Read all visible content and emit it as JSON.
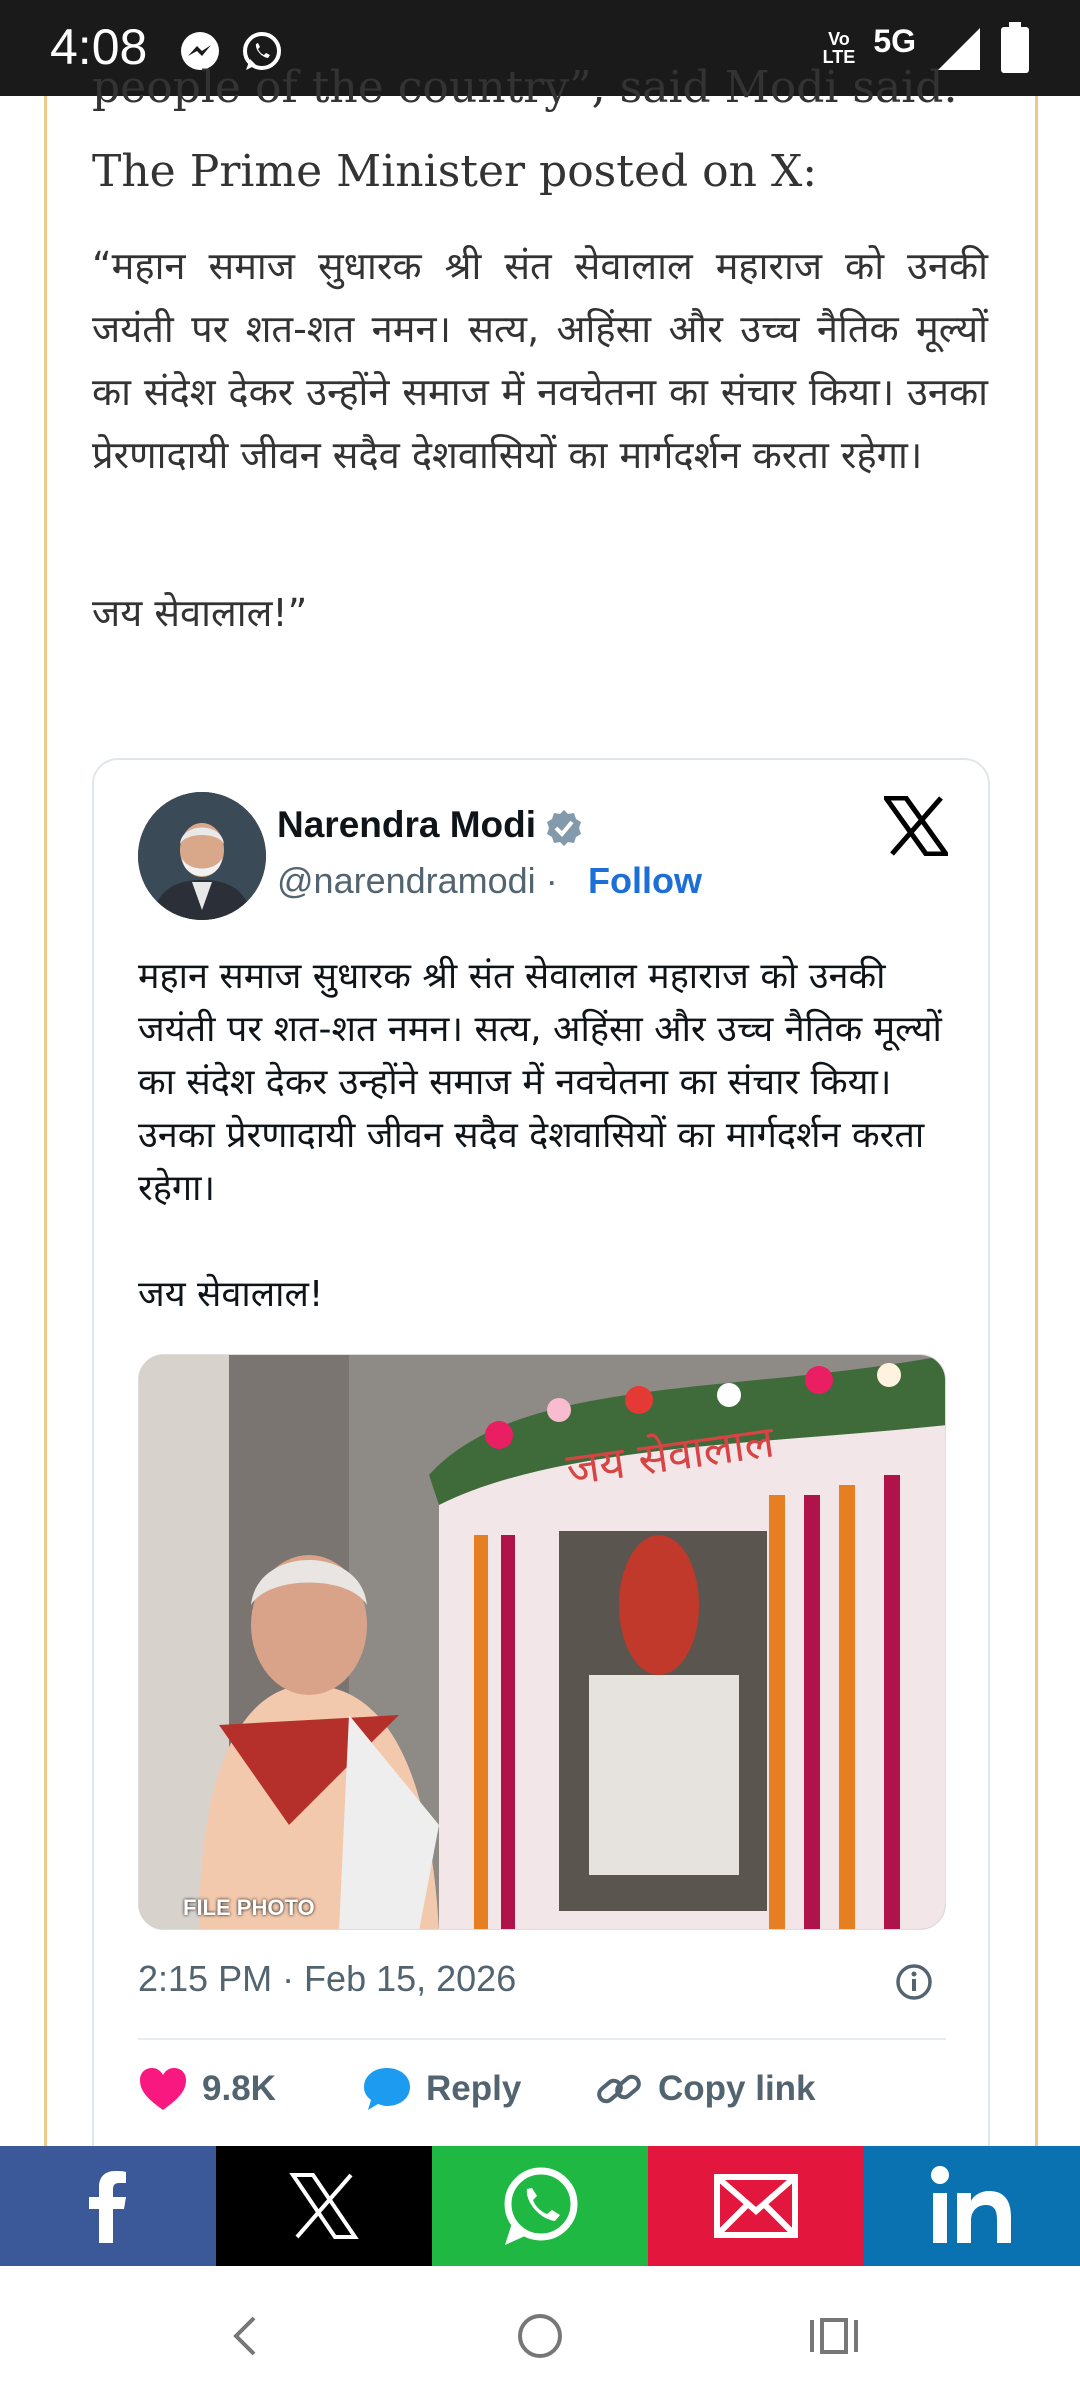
{
  "status_bar": {
    "time": "4:08",
    "volte_line1": "Vo",
    "volte_line2": "LTE",
    "network": "5G",
    "app_icons": [
      "messenger-icon",
      "whatsapp-icon"
    ],
    "right_icons": [
      "signal-icon",
      "battery-icon"
    ]
  },
  "article": {
    "partial_line": "people of the country”, said Modi said.",
    "lead": "The Prime Minister posted on X:",
    "quote_paragraph": "“महान समाज सुधारक श्री संत सेवालाल महाराज को उनकी जयंती पर शत-शत नमन। सत्य, अहिंसा और उच्च नैतिक मूल्यों का संदेश देकर उन्होंने समाज में नवचेतना का संचार किया। उनका प्रेरणादायी जीवन सदैव देशवासियों का मार्गदर्शन करता रहेगा।",
    "quote_end": "जय सेवालाल!”"
  },
  "tweet": {
    "author_name": "Narendra Modi",
    "handle": "@narendramodi",
    "separator": " · ",
    "follow_label": "Follow",
    "text": "महान समाज सुधारक श्री संत सेवालाल महाराज को उनकी जयंती पर शत-शत नमन। सत्य, अहिंसा और उच्च नैतिक मूल्यों का संदेश देकर उन्होंने समाज में नवचेतना का संचार किया। उनका प्रेरणादायी जीवन सदैव देशवासियों का मार्गदर्शन करता रहेगा।",
    "text_2": "जय सेवालाल!",
    "photo_sign": "जय सेवालाल",
    "photo_caption": "FILE PHOTO",
    "timestamp": "2:15 PM · Feb 15, 2026",
    "likes": "9.8K",
    "reply_label": "Reply",
    "copy_link_label": "Copy link",
    "accent_color": "#1d6fd8"
  },
  "share_bar": [
    {
      "name": "facebook",
      "color": "#3b5998",
      "icon": "facebook-icon"
    },
    {
      "name": "x",
      "color": "#000000",
      "icon": "x-icon"
    },
    {
      "name": "whatsapp",
      "color": "#1fb843",
      "icon": "whatsapp-icon"
    },
    {
      "name": "email",
      "color": "#e3173e",
      "icon": "mail-icon"
    },
    {
      "name": "linkedin",
      "color": "#0a72b1",
      "icon": "linkedin-icon"
    }
  ],
  "nav_bar": {
    "icons": [
      "back-icon",
      "home-icon",
      "recents-icon"
    ]
  }
}
